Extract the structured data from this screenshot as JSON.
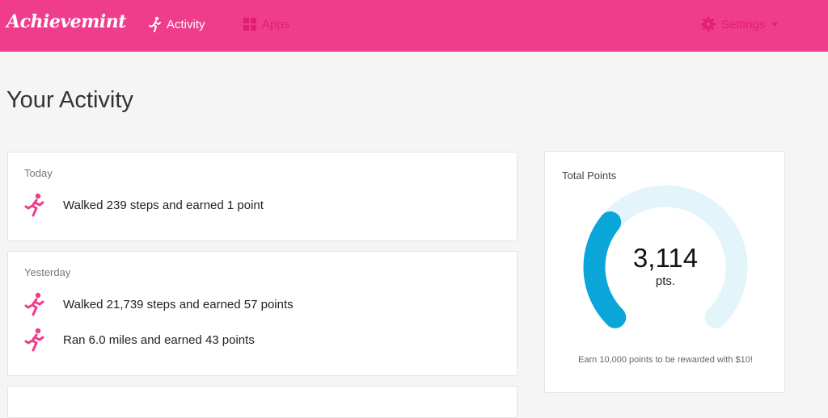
{
  "header": {
    "logo": "Achievemint",
    "nav": {
      "activity": "Activity",
      "apps": "Apps",
      "settings": "Settings"
    },
    "icons": {
      "activity": "runner-icon",
      "apps": "grid-icon",
      "settings": "gear-icon",
      "settings_caret": "caret-down-icon"
    },
    "colors": {
      "bar": "#f03c8c",
      "dim_text": "#e0206e"
    }
  },
  "page": {
    "title": "Your Activity"
  },
  "activity": {
    "today": {
      "label": "Today",
      "items": [
        {
          "icon": "runner-icon",
          "text": "Walked 239 steps and earned 1 point"
        }
      ]
    },
    "yesterday": {
      "label": "Yesterday",
      "items": [
        {
          "icon": "runner-icon",
          "text": "Walked 21,739 steps and earned 57 points"
        },
        {
          "icon": "runner-icon",
          "text": "Ran 6.0 miles and earned 43 points"
        }
      ]
    }
  },
  "points": {
    "title": "Total Points",
    "value": "3,114",
    "unit": "pts.",
    "goal_note": "Earn 10,000 points to be rewarded with $10!",
    "current": 3114,
    "goal": 10000,
    "colors": {
      "progress": "#0aa6da",
      "track": "#e3f4fa"
    }
  }
}
